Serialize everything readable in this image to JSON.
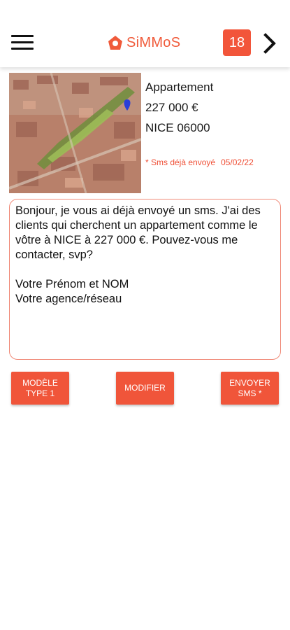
{
  "header": {
    "app_name": "SiMMoS",
    "notification_count": "18",
    "brand_color": "#f05a3a"
  },
  "listing": {
    "property_type": "Appartement",
    "price": "227 000 €",
    "location": "NICE 06000",
    "sms_status": "* Sms déjà envoyé",
    "sms_date": "05/02/22"
  },
  "message": {
    "text": "Bonjour, je vous ai déjà envoyé un sms. J'ai des clients qui cherchent un appartement comme le vôtre à NICE à 227 000 €. Pouvez-vous me contacter, svp?\n\nVotre Prénom et NOM\nVotre agence/réseau"
  },
  "actions": {
    "model_label": "Modèle Type 1",
    "edit_label": "Modifier",
    "send_label": "Envoyer SMS *"
  },
  "icons": {
    "menu": "hamburger-menu-icon",
    "logo": "house-logo-icon",
    "next": "chevron-right-icon",
    "map_pin": "location-pin-icon"
  }
}
